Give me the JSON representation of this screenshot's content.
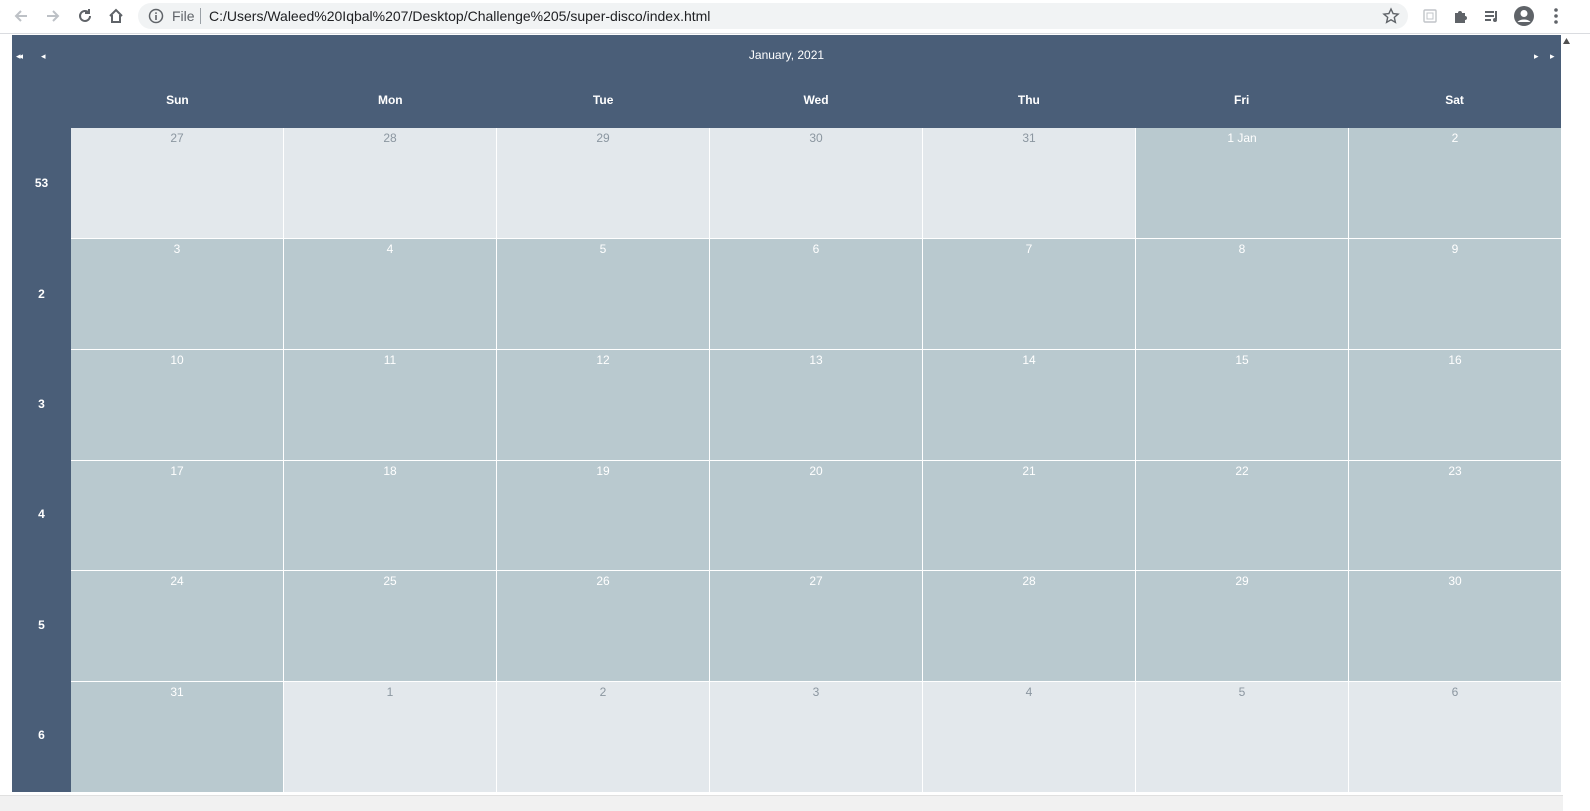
{
  "browser": {
    "file_label": "File",
    "url": "C:/Users/Waleed%20Iqbal%207/Desktop/Challenge%205/super-disco/index.html"
  },
  "calendar": {
    "title": "January, 2021",
    "nav": {
      "prev_year": "◂◂",
      "prev_month": "◂",
      "next_month": "▸",
      "next_year": "▸"
    },
    "weekdays": [
      "Sun",
      "Mon",
      "Tue",
      "Wed",
      "Thu",
      "Fri",
      "Sat"
    ],
    "week_numbers": [
      "53",
      "2",
      "3",
      "4",
      "5",
      "6"
    ],
    "days": [
      {
        "label": "27",
        "other_month": true
      },
      {
        "label": "28",
        "other_month": true
      },
      {
        "label": "29",
        "other_month": true
      },
      {
        "label": "30",
        "other_month": true
      },
      {
        "label": "31",
        "other_month": true
      },
      {
        "label": "1 Jan",
        "other_month": false
      },
      {
        "label": "2",
        "other_month": false
      },
      {
        "label": "3",
        "other_month": false
      },
      {
        "label": "4",
        "other_month": false
      },
      {
        "label": "5",
        "other_month": false
      },
      {
        "label": "6",
        "other_month": false
      },
      {
        "label": "7",
        "other_month": false
      },
      {
        "label": "8",
        "other_month": false
      },
      {
        "label": "9",
        "other_month": false
      },
      {
        "label": "10",
        "other_month": false
      },
      {
        "label": "11",
        "other_month": false
      },
      {
        "label": "12",
        "other_month": false
      },
      {
        "label": "13",
        "other_month": false
      },
      {
        "label": "14",
        "other_month": false
      },
      {
        "label": "15",
        "other_month": false
      },
      {
        "label": "16",
        "other_month": false
      },
      {
        "label": "17",
        "other_month": false
      },
      {
        "label": "18",
        "other_month": false
      },
      {
        "label": "19",
        "other_month": false
      },
      {
        "label": "20",
        "other_month": false
      },
      {
        "label": "21",
        "other_month": false
      },
      {
        "label": "22",
        "other_month": false
      },
      {
        "label": "23",
        "other_month": false
      },
      {
        "label": "24",
        "other_month": false
      },
      {
        "label": "25",
        "other_month": false
      },
      {
        "label": "26",
        "other_month": false
      },
      {
        "label": "27",
        "other_month": false
      },
      {
        "label": "28",
        "other_month": false
      },
      {
        "label": "29",
        "other_month": false
      },
      {
        "label": "30",
        "other_month": false
      },
      {
        "label": "31",
        "other_month": false
      },
      {
        "label": "1",
        "other_month": true
      },
      {
        "label": "2",
        "other_month": true
      },
      {
        "label": "3",
        "other_month": true
      },
      {
        "label": "4",
        "other_month": true
      },
      {
        "label": "5",
        "other_month": true
      },
      {
        "label": "6",
        "other_month": true
      }
    ],
    "colors": {
      "header_bg": "#4a5e78",
      "current_month_cell": "#b9c9cf",
      "other_month_cell": "#e3e8ec"
    }
  }
}
